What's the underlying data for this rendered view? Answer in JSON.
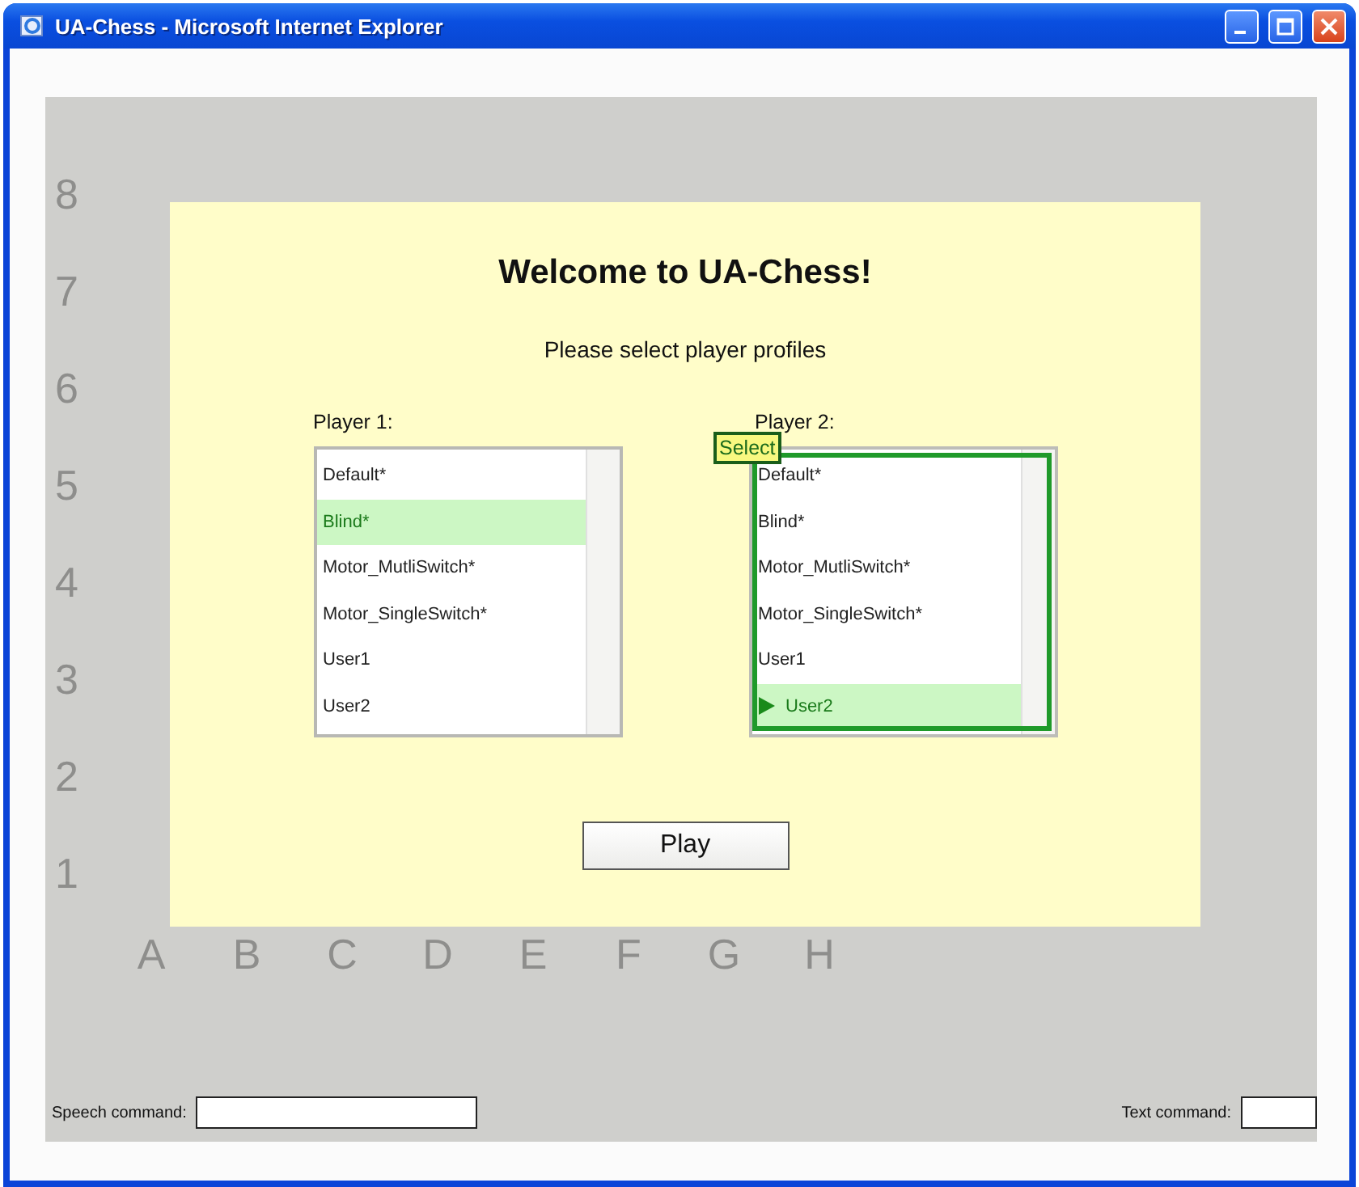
{
  "window": {
    "title": "UA-Chess - Microsoft Internet Explorer"
  },
  "board": {
    "ranks": [
      "8",
      "7",
      "6",
      "5",
      "4",
      "3",
      "2",
      "1"
    ],
    "files": [
      "A",
      "B",
      "C",
      "D",
      "E",
      "F",
      "G",
      "H"
    ]
  },
  "dialog": {
    "title": "Welcome to UA-Chess!",
    "subtitle": "Please select player profiles",
    "players": [
      {
        "label": "Player 1:",
        "focused": false,
        "items": [
          {
            "label": "Default*",
            "selected": false,
            "cursor": false
          },
          {
            "label": "Blind*",
            "selected": true,
            "cursor": false
          },
          {
            "label": "Motor_MutliSwitch*",
            "selected": false,
            "cursor": false
          },
          {
            "label": "Motor_SingleSwitch*",
            "selected": false,
            "cursor": false
          },
          {
            "label": "User1",
            "selected": false,
            "cursor": false
          },
          {
            "label": "User2",
            "selected": false,
            "cursor": false
          }
        ]
      },
      {
        "label": "Player 2:",
        "focused": true,
        "tooltip": "Select",
        "items": [
          {
            "label": "Default*",
            "selected": false,
            "cursor": false
          },
          {
            "label": "Blind*",
            "selected": false,
            "cursor": false
          },
          {
            "label": "Motor_MutliSwitch*",
            "selected": false,
            "cursor": false
          },
          {
            "label": "Motor_SingleSwitch*",
            "selected": false,
            "cursor": false
          },
          {
            "label": "User1",
            "selected": false,
            "cursor": false
          },
          {
            "label": "User2",
            "selected": true,
            "cursor": true
          }
        ]
      }
    ],
    "play_button": "Play"
  },
  "command_bar": {
    "speech_label": "Speech command:",
    "text_label": "Text command:"
  }
}
